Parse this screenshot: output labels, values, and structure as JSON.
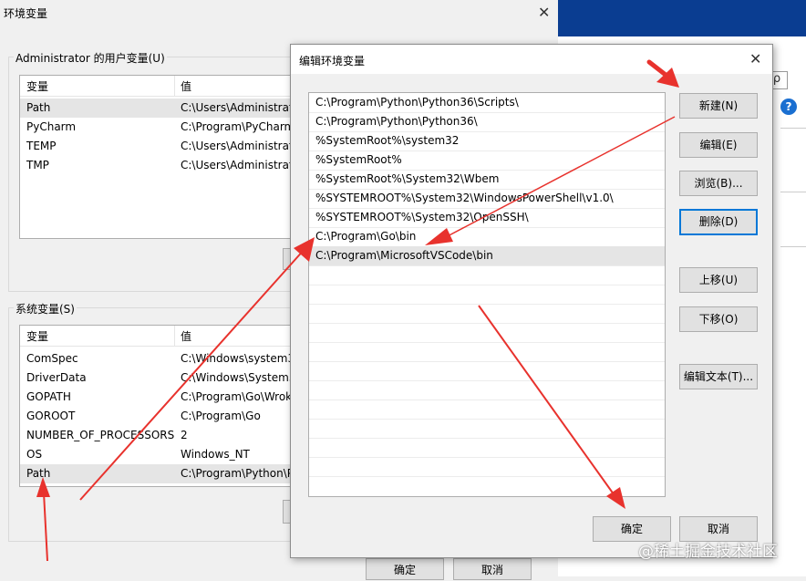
{
  "env_window": {
    "title": "环境变量",
    "user_group_label": "Administrator 的用户变量(U)",
    "system_group_label": "系统变量(S)",
    "col_variable": "变量",
    "col_value": "值",
    "user_vars": [
      {
        "name": "Path",
        "value": "C:\\Users\\Administrat"
      },
      {
        "name": "PyCharm",
        "value": "C:\\Program\\PyCharm"
      },
      {
        "name": "TEMP",
        "value": "C:\\Users\\Administrat"
      },
      {
        "name": "TMP",
        "value": "C:\\Users\\Administrat"
      }
    ],
    "system_vars": [
      {
        "name": "ComSpec",
        "value": "C:\\Windows\\system3"
      },
      {
        "name": "DriverData",
        "value": "C:\\Windows\\System3"
      },
      {
        "name": "GOPATH",
        "value": "C:\\Program\\Go\\Wrok"
      },
      {
        "name": "GOROOT",
        "value": "C:\\Program\\Go"
      },
      {
        "name": "NUMBER_OF_PROCESSORS",
        "value": "2"
      },
      {
        "name": "OS",
        "value": "Windows_NT"
      },
      {
        "name": "Path",
        "value": "C:\\Program\\Python\\P"
      }
    ],
    "ok_label": "确定",
    "cancel_label": "取消"
  },
  "edit_dialog": {
    "title": "编辑环境变量",
    "paths": [
      "C:\\Program\\Python\\Python36\\Scripts\\",
      "C:\\Program\\Python\\Python36\\",
      "%SystemRoot%\\system32",
      "%SystemRoot%",
      "%SystemRoot%\\System32\\Wbem",
      "%SYSTEMROOT%\\System32\\WindowsPowerShell\\v1.0\\",
      "%SYSTEMROOT%\\System32\\OpenSSH\\",
      "C:\\Program\\Go\\bin",
      "C:\\Program\\MicrosoftVSCode\\bin"
    ],
    "buttons": {
      "new": "新建(N)",
      "edit": "编辑(E)",
      "browse": "浏览(B)...",
      "delete": "删除(D)",
      "move_up": "上移(U)",
      "move_down": "下移(O)",
      "edit_text": "编辑文本(T)...",
      "ok": "确定",
      "cancel": "取消"
    }
  },
  "desktop": {
    "help_glyph": "?",
    "search_glyph": "ρ"
  },
  "watermark": "@稀土掘金技术社区",
  "colors": {
    "arrow": "#e8322d",
    "accent": "#0078d7",
    "desktop": "#0a3d91"
  }
}
